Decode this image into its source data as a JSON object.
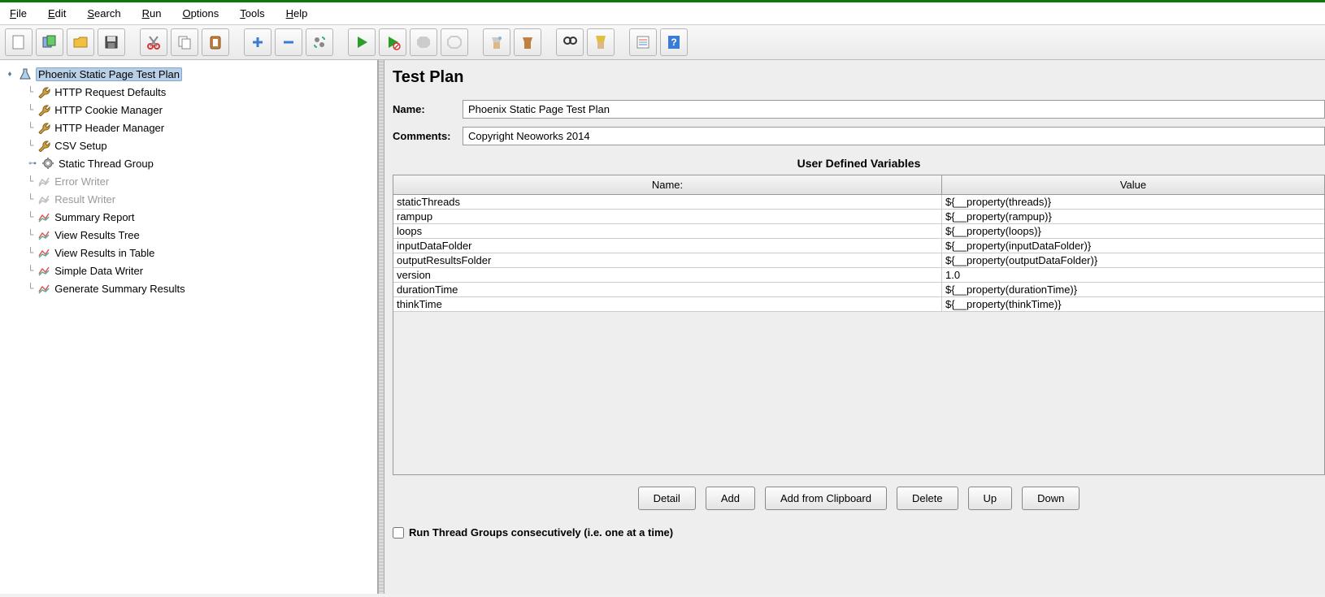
{
  "menubar": [
    "File",
    "Edit",
    "Search",
    "Run",
    "Options",
    "Tools",
    "Help"
  ],
  "tree": {
    "root": "Phoenix Static Page Test Plan",
    "children": [
      {
        "label": "HTTP Request Defaults",
        "icon": "wrench",
        "disabled": false
      },
      {
        "label": "HTTP Cookie Manager",
        "icon": "wrench",
        "disabled": false
      },
      {
        "label": "HTTP Header Manager",
        "icon": "wrench",
        "disabled": false
      },
      {
        "label": "CSV Setup",
        "icon": "wrench",
        "disabled": false
      },
      {
        "label": "Static Thread Group",
        "icon": "gear",
        "disabled": false,
        "expandable": true
      },
      {
        "label": "Error Writer",
        "icon": "chart-gray",
        "disabled": true
      },
      {
        "label": "Result Writer",
        "icon": "chart-gray",
        "disabled": true
      },
      {
        "label": "Summary Report",
        "icon": "chart",
        "disabled": false
      },
      {
        "label": "View Results Tree",
        "icon": "chart",
        "disabled": false
      },
      {
        "label": "View Results in Table",
        "icon": "chart",
        "disabled": false
      },
      {
        "label": "Simple Data Writer",
        "icon": "chart",
        "disabled": false
      },
      {
        "label": "Generate Summary Results",
        "icon": "chart",
        "disabled": false
      }
    ]
  },
  "editor": {
    "title": "Test Plan",
    "name_label": "Name:",
    "name_value": "Phoenix Static Page Test Plan",
    "comments_label": "Comments:",
    "comments_value": "Copyright Neoworks 2014",
    "vars_title": "User Defined Variables",
    "col_name": "Name:",
    "col_value": "Value",
    "vars": [
      {
        "name": "staticThreads",
        "value": "${__property(threads)}"
      },
      {
        "name": "rampup",
        "value": "${__property(rampup)}"
      },
      {
        "name": "loops",
        "value": "${__property(loops)}"
      },
      {
        "name": "inputDataFolder",
        "value": "${__property(inputDataFolder)}"
      },
      {
        "name": "outputResultsFolder",
        "value": "${__property(outputDataFolder)}"
      },
      {
        "name": "version",
        "value": "1.0"
      },
      {
        "name": "durationTime",
        "value": "${__property(durationTime)}"
      },
      {
        "name": "thinkTime",
        "value": "${__property(thinkTime)}"
      }
    ],
    "buttons": [
      "Detail",
      "Add",
      "Add from Clipboard",
      "Delete",
      "Up",
      "Down"
    ],
    "checkbox_label": "Run Thread Groups consecutively (i.e. one at a time)"
  }
}
